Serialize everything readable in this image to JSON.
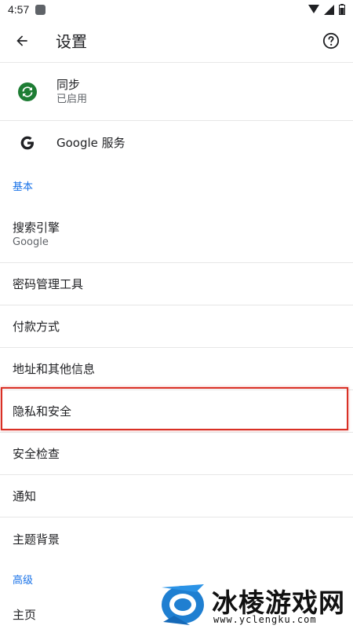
{
  "status_bar": {
    "time": "4:57"
  },
  "app_bar": {
    "title": "设置"
  },
  "account": {
    "sync_title": "同步",
    "sync_subtitle": "已启用",
    "google_services": "Google 服务"
  },
  "sections": {
    "basic_header": "基本",
    "advanced_header": "高级"
  },
  "items": {
    "search_engine": "搜索引擎",
    "search_engine_value": "Google",
    "passwords": "密码管理工具",
    "payment": "付款方式",
    "addresses": "地址和其他信息",
    "privacy": "隐私和安全",
    "safety_check": "安全检查",
    "notifications": "通知",
    "theme": "主题背景",
    "homepage": "主页"
  },
  "watermark": {
    "name": "冰棱游戏网",
    "url": "www.yclengku.com"
  },
  "colors": {
    "accent": "#1a73e8",
    "sync_green": "#1e7d34",
    "highlight": "#d93025"
  }
}
